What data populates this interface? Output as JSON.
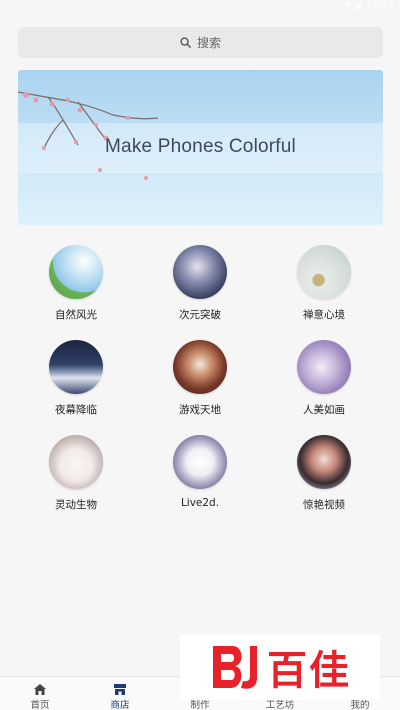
{
  "status_bar": {
    "time": "13:02"
  },
  "search": {
    "placeholder": "搜索",
    "icon": "search-icon"
  },
  "banner": {
    "tagline": "Make Phones Colorful"
  },
  "categories": [
    {
      "label": "自然风光",
      "icon": "nature-landscape-image"
    },
    {
      "label": "次元突破",
      "icon": "anime-image"
    },
    {
      "label": "禅意心境",
      "icon": "zen-image"
    },
    {
      "label": "夜幕降临",
      "icon": "night-sky-image"
    },
    {
      "label": "游戏天地",
      "icon": "game-image"
    },
    {
      "label": "人美如画",
      "icon": "portrait-image"
    },
    {
      "label": "灵动生物",
      "icon": "cat-image"
    },
    {
      "label": "Live2d.",
      "icon": "live2d-image"
    },
    {
      "label": "惊艳视频",
      "icon": "video-image"
    }
  ],
  "tabs": [
    {
      "label": "首页",
      "icon": "home-icon",
      "active": false
    },
    {
      "label": "商店",
      "icon": "store-icon",
      "active": true
    },
    {
      "label": "制作",
      "icon": "make-icon",
      "active": false
    },
    {
      "label": "工艺坊",
      "icon": "workshop-icon",
      "active": false
    },
    {
      "label": "我的",
      "icon": "profile-icon",
      "active": false
    }
  ],
  "watermark": {
    "text": "百佳"
  },
  "colors": {
    "accent": "#1e3a7a",
    "watermark": "#e8222b",
    "background": "#f6f6f6"
  }
}
